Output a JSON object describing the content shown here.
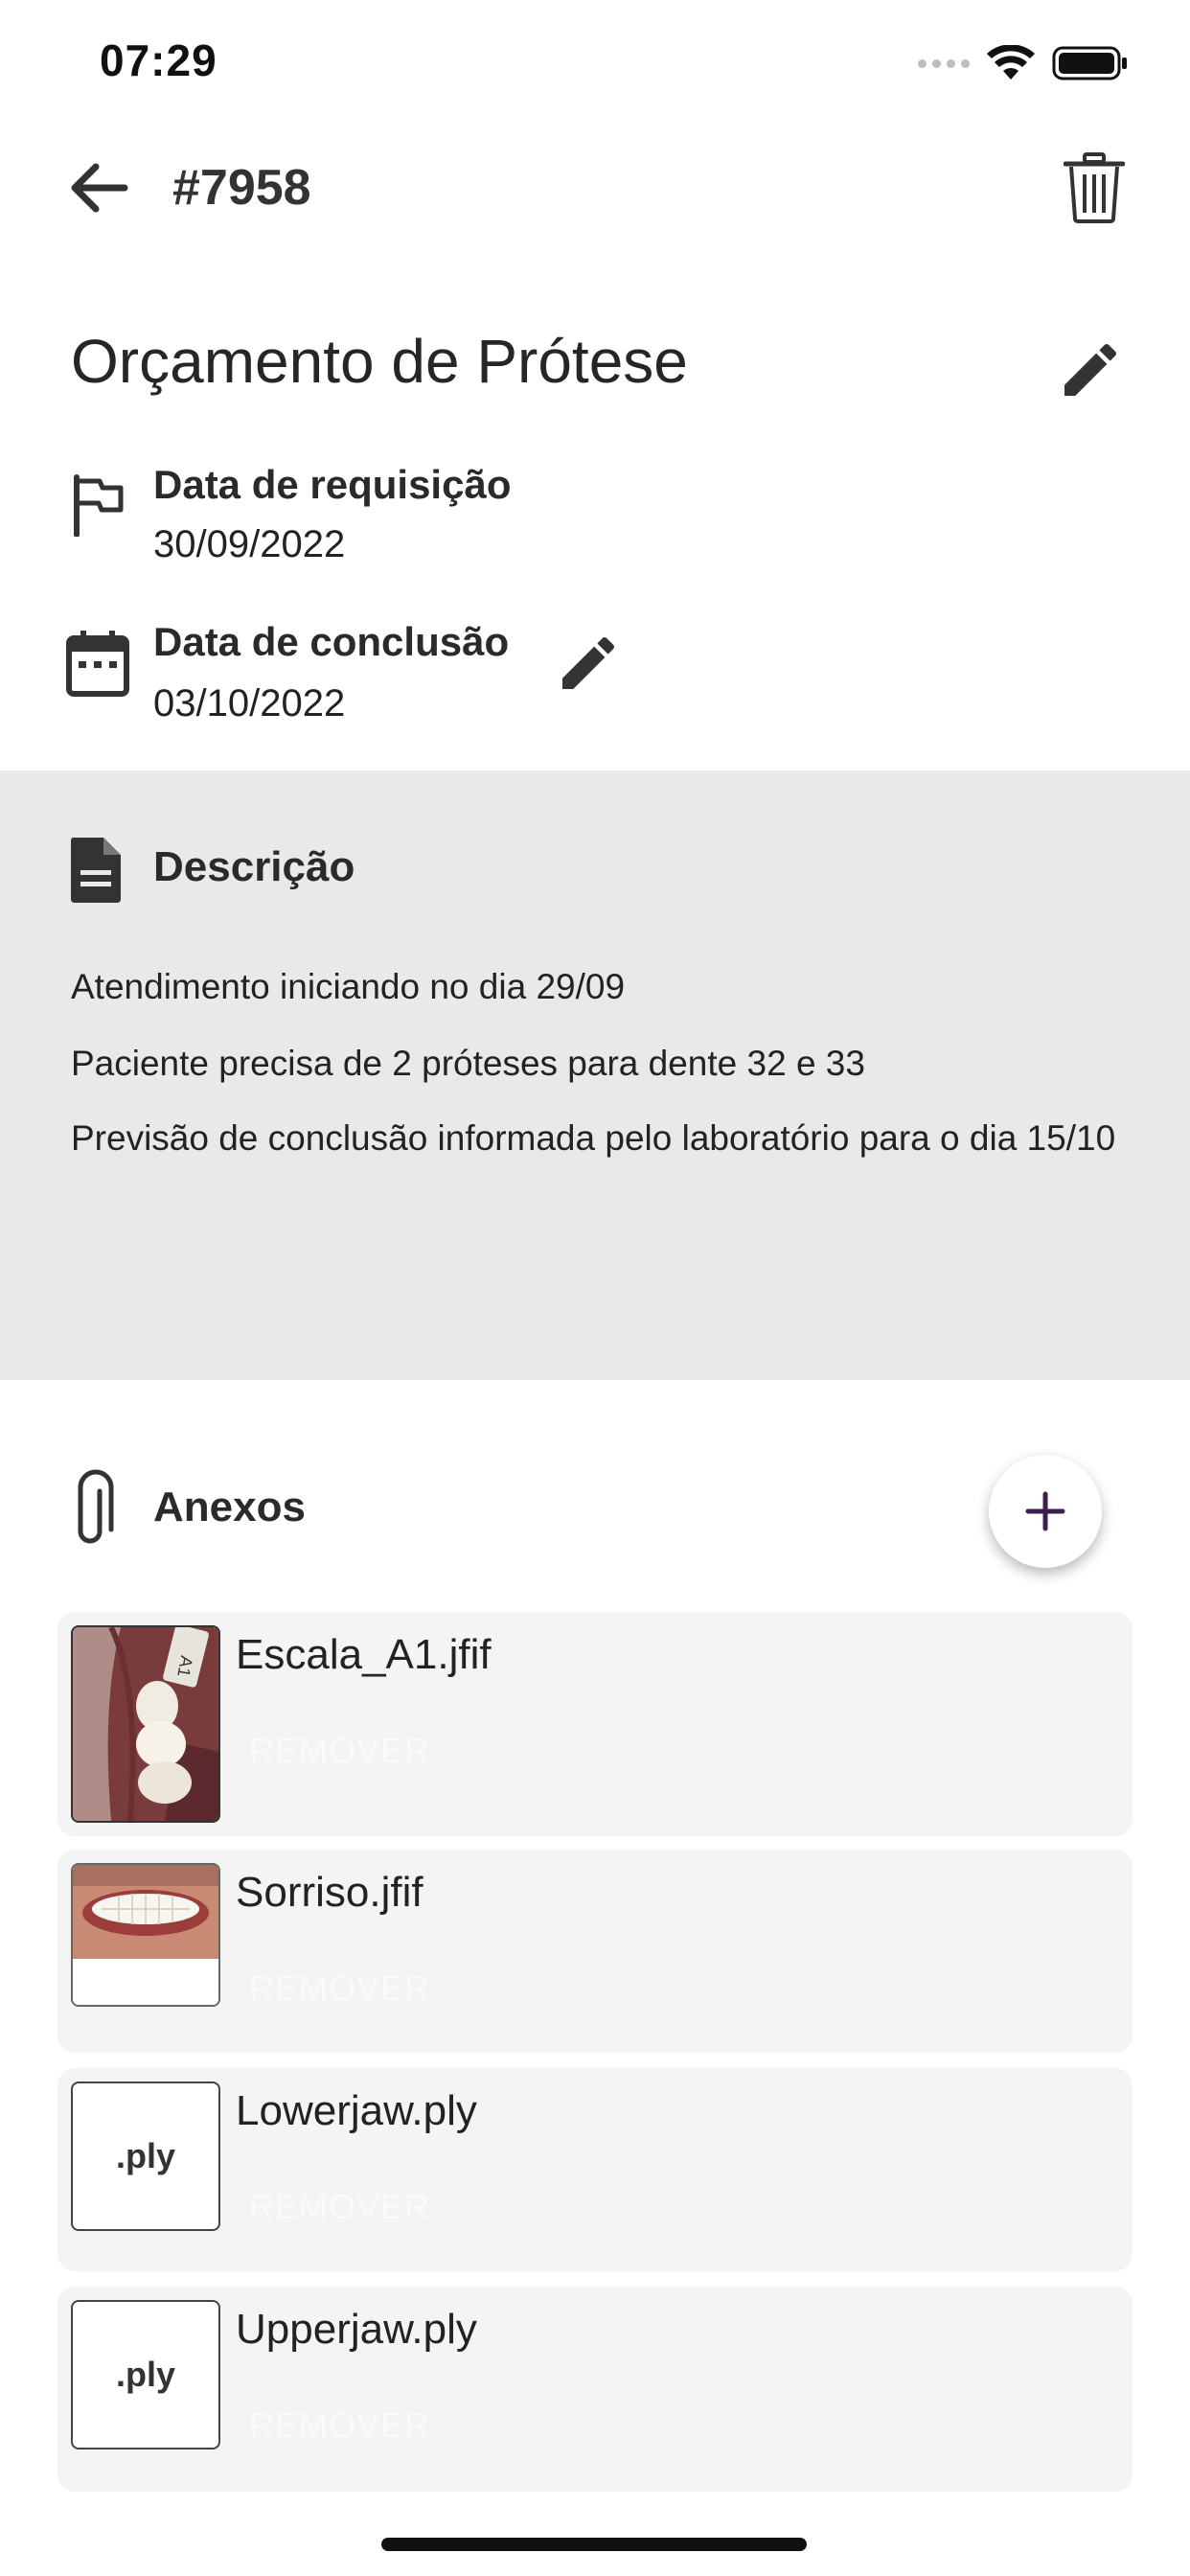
{
  "status_bar": {
    "time": "07:29"
  },
  "header": {
    "order_id": "#7958"
  },
  "title": "Orçamento de Prótese",
  "fields": {
    "request": {
      "label": "Data de requisição",
      "value": "30/09/2022"
    },
    "completion": {
      "label": "Data de conclusão",
      "value": "03/10/2022"
    }
  },
  "description": {
    "title": "Descrição",
    "paragraphs": [
      "Atendimento iniciando no dia 29/09",
      "Paciente precisa de 2 próteses para dente 32 e 33",
      "Previsão de conclusão informada pelo laboratório para o dia 15/10"
    ]
  },
  "attachments": {
    "title": "Anexos",
    "remove_label": "REMOVER",
    "items": [
      {
        "name": "Escala_A1.jfif",
        "thumb": "image"
      },
      {
        "name": "Sorriso.jfif",
        "thumb": "image"
      },
      {
        "name": "Lowerjaw.ply",
        "thumb": ".ply"
      },
      {
        "name": "Upperjaw.ply",
        "thumb": ".ply"
      }
    ]
  },
  "icons": [
    "back-arrow-icon",
    "trash-icon",
    "pencil-icon",
    "flag-icon",
    "calendar-icon",
    "document-icon",
    "paperclip-icon",
    "plus-icon"
  ],
  "colors": {
    "fab_plus": "#3d1f4d",
    "description_bg": "#e9e9e9",
    "card_bg": "#f4f4f4"
  }
}
